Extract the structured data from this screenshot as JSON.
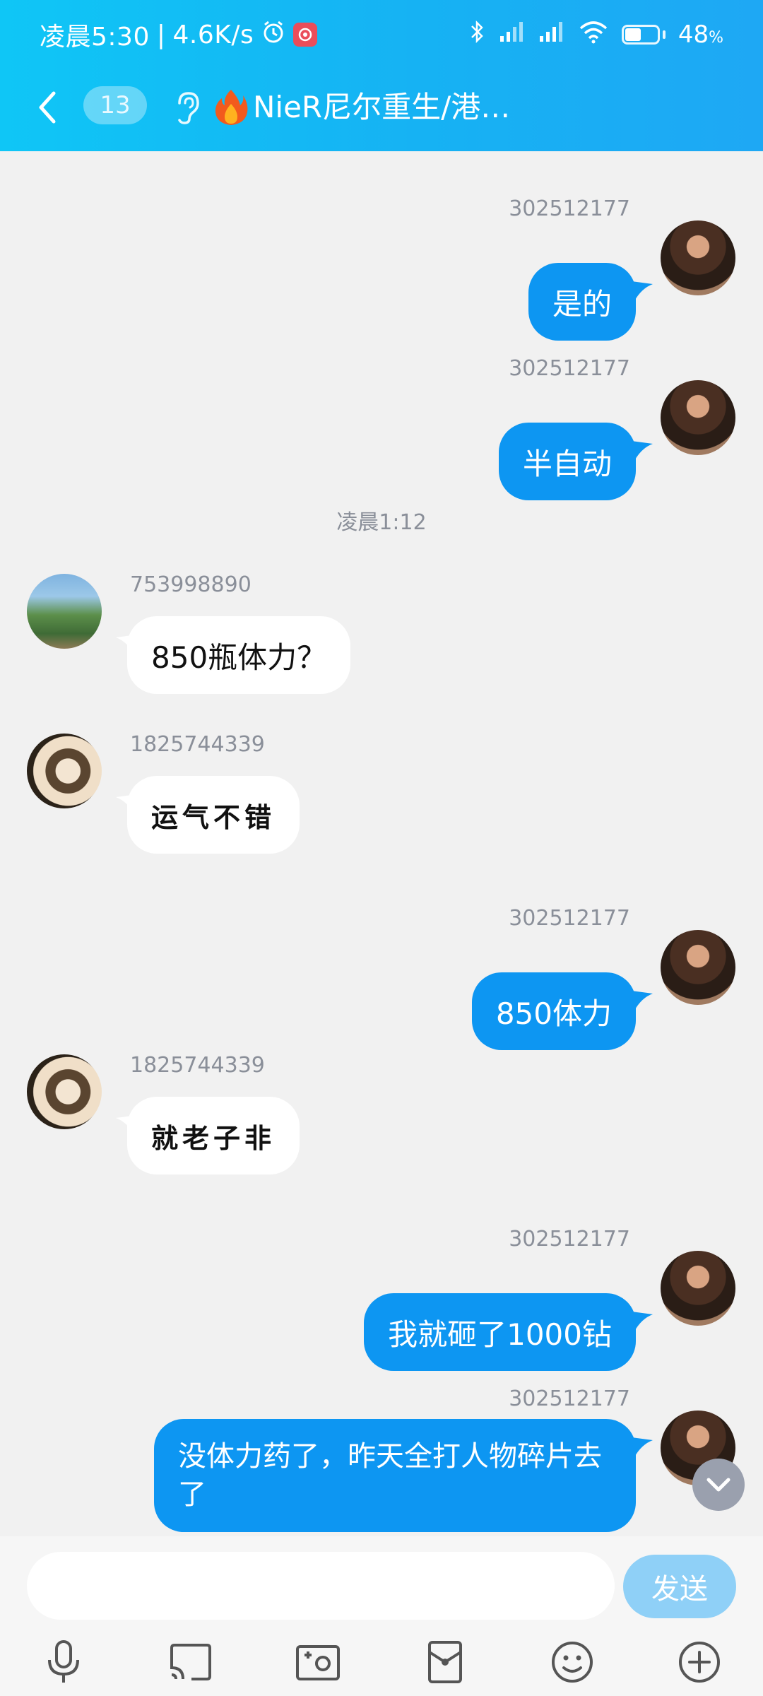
{
  "status_bar": {
    "time": "凌晨5:30",
    "separator": "|",
    "speed": "4.6K/s",
    "battery": "48",
    "battery_unit": "%"
  },
  "nav": {
    "unread_count": "13",
    "title": "NieR尼尔重生/港…"
  },
  "messages": [
    {
      "sender": "302512177",
      "text": "是的",
      "direction": "out"
    },
    {
      "sender": "302512177",
      "text": "半自动",
      "direction": "out"
    },
    {
      "sender": "753998890",
      "text": "850瓶体力？",
      "direction": "in"
    },
    {
      "sender": "1825744339",
      "text": "运气不错",
      "direction": "in"
    },
    {
      "sender": "302512177",
      "text": "850体力",
      "direction": "out"
    },
    {
      "sender": "1825744339",
      "text": "就老子非",
      "direction": "in"
    },
    {
      "sender": "302512177",
      "text": "我就砸了1000钻",
      "direction": "out"
    },
    {
      "sender": "302512177",
      "text": "没体力药了，昨天全打人物碎片去了",
      "direction": "out"
    }
  ],
  "time_divider": "凌晨1:12",
  "input": {
    "value": "",
    "placeholder": "",
    "send_label": "发送"
  },
  "toolbar_icons": [
    "microphone-icon",
    "cast-screen-icon",
    "photo-icon",
    "red-packet-icon",
    "emoji-icon",
    "plus-icon"
  ],
  "colors": {
    "header_start": "#0fc6f6",
    "header_end": "#1ea8f4",
    "bubble_out": "#0d96f2",
    "bubble_in": "#ffffff",
    "background": "#f1f1f1",
    "send_button": "#8fd0f7"
  }
}
